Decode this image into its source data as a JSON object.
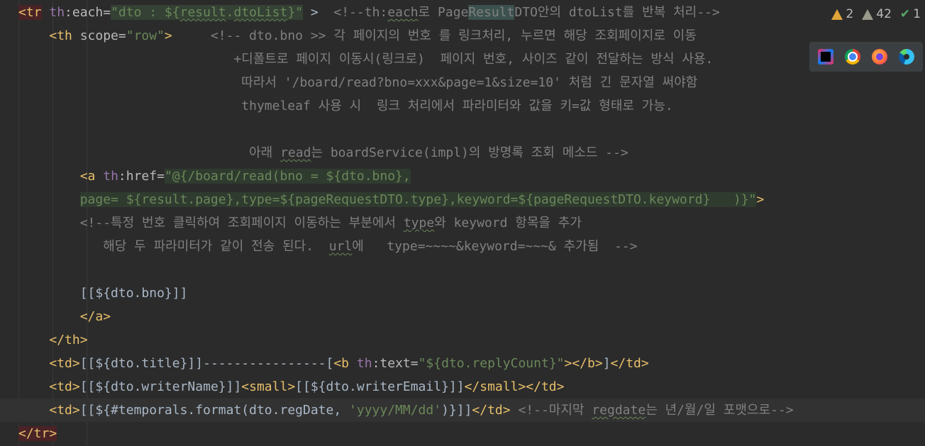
{
  "inspections": {
    "warnings": "2",
    "weak_warnings": "42",
    "typos": "1"
  },
  "browsers": [
    "intellij-icon",
    "chrome-icon",
    "firefox-icon",
    "edge-icon"
  ],
  "colors": {
    "background": "#2b2b2b",
    "tag": "#e8bf6a",
    "string": "#6a8759",
    "comment": "#808080",
    "namespace": "#9876aa"
  },
  "lines": [
    {
      "tokens": [
        {
          "t": "<tr",
          "c": "tag trbox"
        },
        {
          "t": " "
        },
        {
          "t": "th",
          "c": "ns"
        },
        {
          "t": ":each=",
          "c": "attr"
        },
        {
          "t": "\"dto : ${",
          "c": "str hl"
        },
        {
          "t": "result",
          "c": "str hl sq"
        },
        {
          "t": ".",
          "c": "str hl"
        },
        {
          "t": "dtoList",
          "c": "str hl sq"
        },
        {
          "t": "}\"",
          "c": "str hl"
        },
        {
          "t": " >  "
        },
        {
          "t": "<!--th:",
          "c": "com"
        },
        {
          "t": "each",
          "c": "com sq"
        },
        {
          "t": "로 Page",
          "c": "com"
        },
        {
          "t": "Result",
          "c": "com match"
        },
        {
          "t": "DTO안의 dtoList를 반복 처리-->",
          "c": "com"
        }
      ]
    },
    {
      "tokens": [
        {
          "t": "    "
        },
        {
          "t": "<th",
          "c": "tag"
        },
        {
          "t": " scope=",
          "c": "attr"
        },
        {
          "t": "\"row\"",
          "c": "str"
        },
        {
          "t": ">",
          "c": "tag"
        },
        {
          "t": "     "
        },
        {
          "t": "<!-- dto.bno >> 각 페이지의 번호 를 링크처리, 누르면 해당 조회페이지로 이동",
          "c": "com"
        }
      ]
    },
    {
      "tokens": [
        {
          "t": "                            "
        },
        {
          "t": "+디폴트로 페이지 이동시(링크로)  페이지 번호, 사이즈 같이 전달하는 방식 사용.",
          "c": "com"
        }
      ]
    },
    {
      "tokens": [
        {
          "t": "                             "
        },
        {
          "t": "따라서 '/board/read?bno=xxx&page=1&size=10' 처럼 긴 문자열 써야함",
          "c": "com"
        }
      ]
    },
    {
      "tokens": [
        {
          "t": "                             "
        },
        {
          "t": "thymeleaf 사용 시  링크 처리에서 파라미터와 값을 키=값 형태로 가능.",
          "c": "com"
        }
      ]
    },
    {
      "tokens": []
    },
    {
      "tokens": [
        {
          "t": "                              "
        },
        {
          "t": "아래 ",
          "c": "com"
        },
        {
          "t": "read",
          "c": "com sq"
        },
        {
          "t": "는 boardService(impl)의 방명록 조회 메소드 -->",
          "c": "com"
        }
      ]
    },
    {
      "tokens": [
        {
          "t": "        "
        },
        {
          "t": "<a",
          "c": "tag"
        },
        {
          "t": " "
        },
        {
          "t": "th",
          "c": "ns"
        },
        {
          "t": ":href=",
          "c": "attr"
        },
        {
          "t": "\"@{/board/read(bno = ${dto.bno},",
          "c": "str hlblock"
        }
      ]
    },
    {
      "tokens": [
        {
          "t": "        "
        },
        {
          "t": "page= ${result.page},type=${pageRequestDTO.type},keyword=${pageRequestDTO.keyword}   )}\"",
          "c": "str hlblock"
        },
        {
          "t": ">",
          "c": "tag"
        }
      ]
    },
    {
      "tokens": [
        {
          "t": "        "
        },
        {
          "t": "<!--특정 번호 클릭하여 조회페이지 이동하는 부분에서 ",
          "c": "com"
        },
        {
          "t": "type",
          "c": "com sq"
        },
        {
          "t": "와 keyword 항목을 추가",
          "c": "com"
        }
      ]
    },
    {
      "tokens": [
        {
          "t": "           "
        },
        {
          "t": "해당 두 파라미터가 같이 전송 된다.  ",
          "c": "com"
        },
        {
          "t": "url",
          "c": "com sq"
        },
        {
          "t": "에   type=~~~~&keyword=~~~& 추가됨  -->",
          "c": "com"
        }
      ]
    },
    {
      "tokens": []
    },
    {
      "tokens": [
        {
          "t": "        [[${dto.bno}]]"
        }
      ]
    },
    {
      "tokens": [
        {
          "t": "        "
        },
        {
          "t": "</a>",
          "c": "tag"
        }
      ]
    },
    {
      "tokens": [
        {
          "t": "    "
        },
        {
          "t": "</th>",
          "c": "tag"
        }
      ]
    },
    {
      "tokens": [
        {
          "t": "    "
        },
        {
          "t": "<td>",
          "c": "tag"
        },
        {
          "t": "[[${dto.title}]]----------------["
        },
        {
          "t": "<b",
          "c": "tag"
        },
        {
          "t": " "
        },
        {
          "t": "th",
          "c": "ns"
        },
        {
          "t": ":text=",
          "c": "attr"
        },
        {
          "t": "\"${dto.replyCount}\"",
          "c": "str"
        },
        {
          "t": "></b>",
          "c": "tag"
        },
        {
          "t": "]"
        },
        {
          "t": "</td>",
          "c": "tag"
        }
      ]
    },
    {
      "tokens": [
        {
          "t": "    "
        },
        {
          "t": "<td>",
          "c": "tag"
        },
        {
          "t": "[[${dto.writerName}]]"
        },
        {
          "t": "<small>",
          "c": "tag"
        },
        {
          "t": "[[${dto.writerEmail}]]"
        },
        {
          "t": "</small></td>",
          "c": "tag"
        }
      ]
    },
    {
      "tokens": [
        {
          "t": "    "
        },
        {
          "t": "<td>",
          "c": "tag"
        },
        {
          "t": "[[${#temporals.format(dto.regDate, "
        },
        {
          "t": "'yyyy/MM/dd'",
          "c": "str"
        },
        {
          "t": ")}]]"
        },
        {
          "t": "</td>",
          "c": "tag"
        },
        {
          "t": " "
        },
        {
          "t": "<!--마지막 ",
          "c": "com"
        },
        {
          "t": "regdate",
          "c": "com sq"
        },
        {
          "t": "는 년/월/일 포맷으로-->",
          "c": "com"
        }
      ]
    },
    {
      "tokens": [
        {
          "t": "</tr>",
          "c": "tag trbox"
        }
      ]
    }
  ]
}
